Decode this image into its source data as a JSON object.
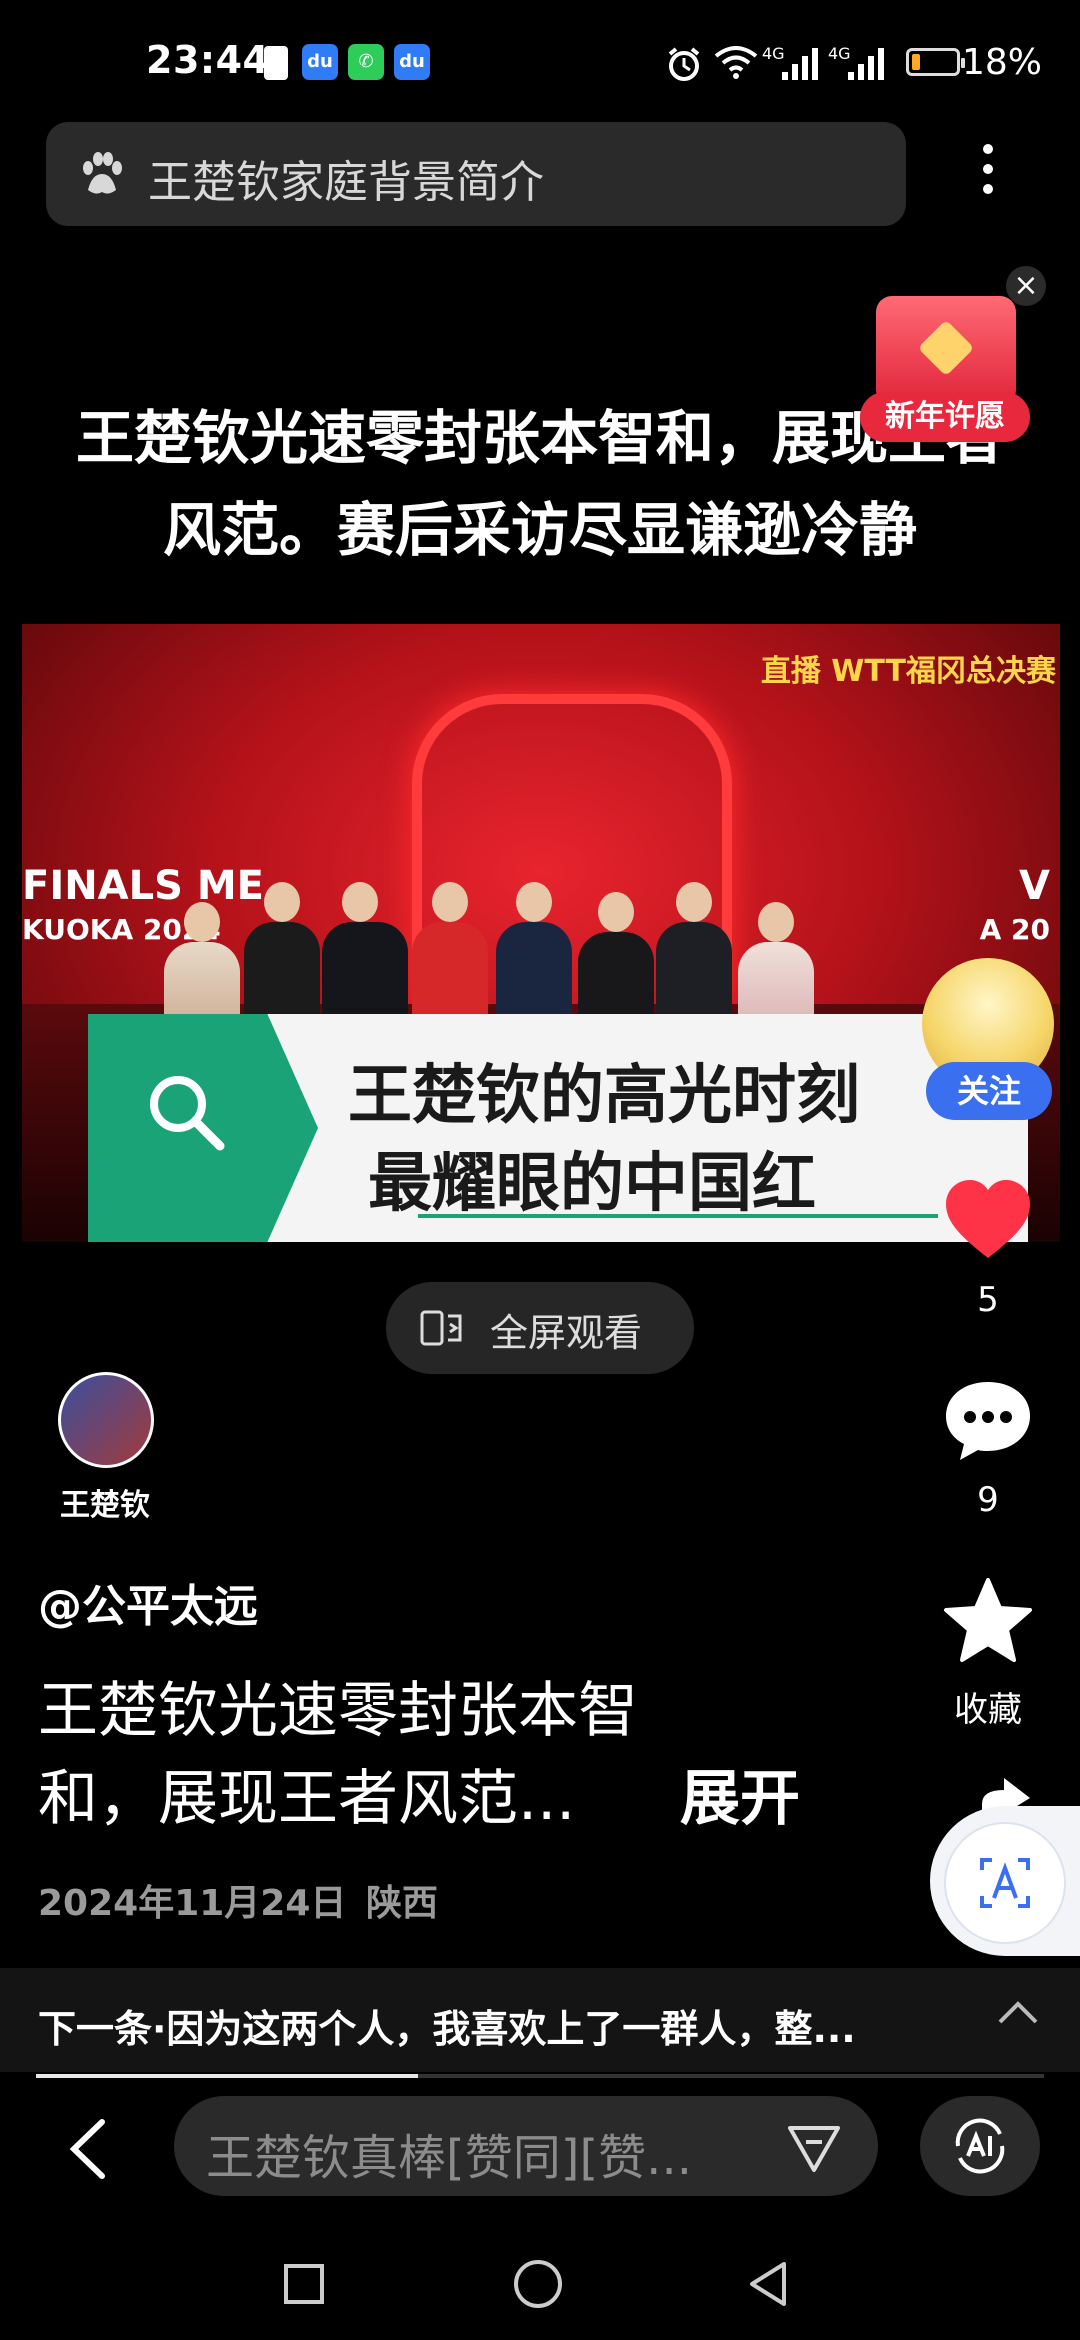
{
  "status_bar": {
    "time": "23:44",
    "mini_icons": [
      "du",
      "✆",
      "du"
    ],
    "signal_1": "4G",
    "signal_2": "4G",
    "battery_percent": "18%",
    "battery_level": 0.18
  },
  "search": {
    "query": "王楚钦家庭背景简介"
  },
  "promo": {
    "label": "新年许愿",
    "close": "×"
  },
  "post": {
    "headline_line1": "王楚钦光速零封张本智和，展现王者",
    "headline_line2": "风范。赛后采访尽显谦逊冷静",
    "video": {
      "live_tag": "直播 WTT福冈总决赛",
      "wall_left_1": "FINALS ME",
      "wall_left_2": "KUOKA 2024",
      "wall_right_1": "V",
      "wall_right_2": "A 20",
      "caption_line1": "王楚钦的高光时刻",
      "caption_line2": "最耀眼的中国红"
    },
    "fullscreen_label": "全屏观看",
    "author_name": "王楚钦",
    "handle": "@公平太远",
    "desc_line1": "王楚钦光速零封张本智",
    "desc_line2": "和，展现王者风范...",
    "expand_label": "展开",
    "date": "2024年11月24日",
    "location": "陕西"
  },
  "rail": {
    "follow_label": "关注",
    "like_count": "5",
    "comment_count": "9",
    "favorite_label": "收藏"
  },
  "next": {
    "text": "下一条·因为这两个人，我喜欢上了一群人，整..."
  },
  "comment": {
    "placeholder": "王楚钦真棒[赞同][赞..."
  },
  "colors": {
    "accent_blue": "#3a6ff0",
    "heart_red": "#ff3347",
    "video_red": "#b0141b",
    "caption_green": "#1aa377"
  },
  "icons": [
    "paw-icon",
    "more-icon",
    "heart-icon",
    "comment-icon",
    "star-icon",
    "share-icon",
    "translate-icon",
    "fullscreen-icon",
    "search-icon",
    "back-icon",
    "send-icon",
    "ai-icon"
  ]
}
